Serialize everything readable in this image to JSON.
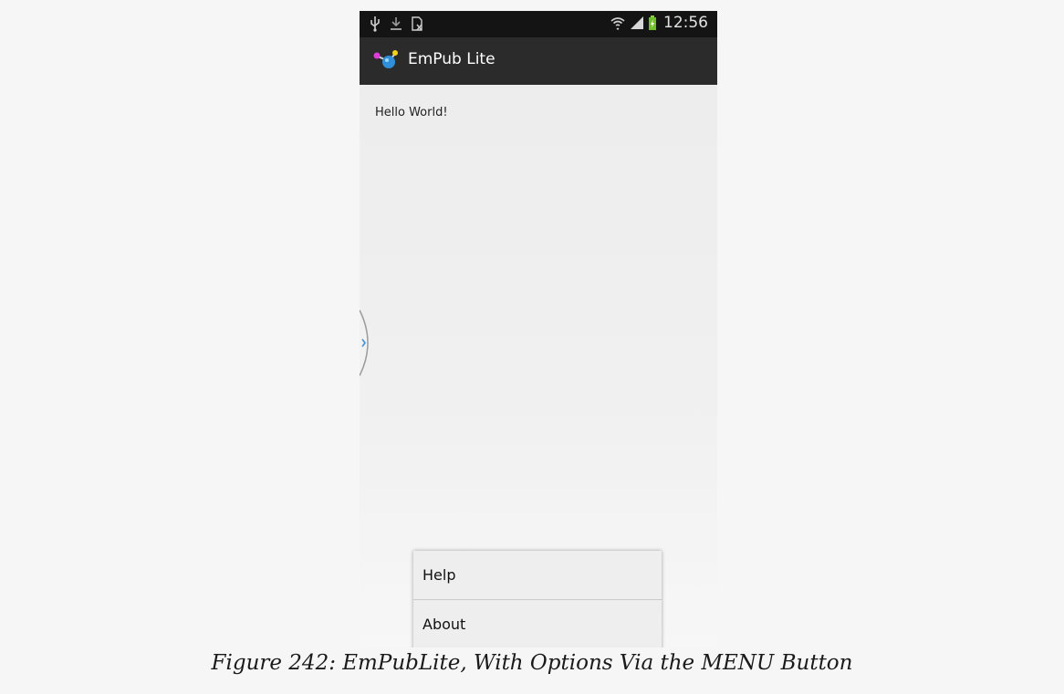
{
  "status_bar": {
    "left_icons": [
      "usb-icon",
      "download-icon",
      "sim-icon"
    ],
    "right_icons": [
      "wifi-icon",
      "signal-icon",
      "battery-icon"
    ],
    "time": "12:56"
  },
  "action_bar": {
    "icon": "app-logo-icon",
    "title": "EmPub Lite"
  },
  "content": {
    "text": "Hello World!"
  },
  "options_menu": {
    "items": [
      {
        "label": "Help"
      },
      {
        "label": "About"
      }
    ]
  },
  "caption": "Figure 242: EmPubLite, With Options Via the MENU Button"
}
